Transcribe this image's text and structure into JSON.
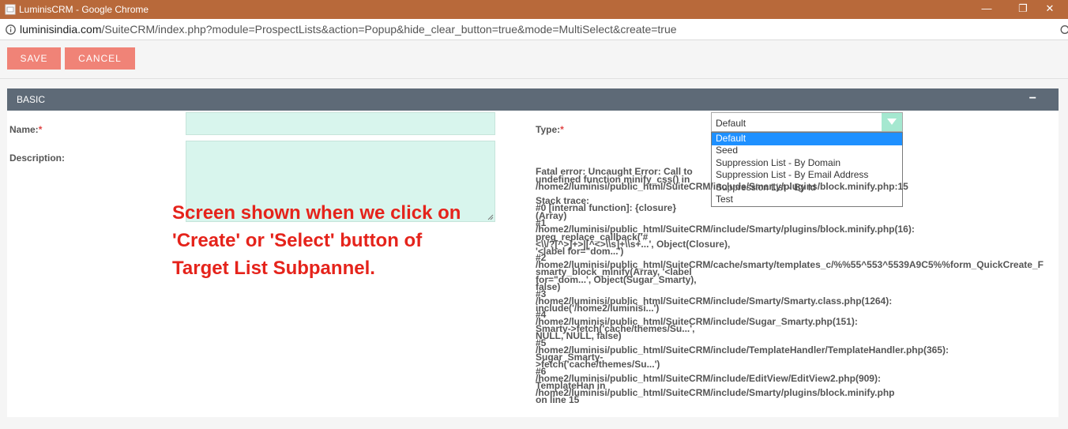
{
  "window": {
    "title": "LuminisCRM - Google Chrome",
    "minimize_glyph": "—",
    "restore_glyph": "❐",
    "close_glyph": "✕"
  },
  "address": {
    "host": "luminisindia.com",
    "path": "/SuiteCRM/index.php?module=ProspectLists&action=Popup&hide_clear_button=true&mode=MultiSelect&create=true"
  },
  "toolbar": {
    "save_label": "SAVE",
    "cancel_label": "CANCEL"
  },
  "panel": {
    "title": "BASIC",
    "collapse_glyph": "−",
    "name_label": "Name:",
    "required_mark": "*",
    "description_label": "Description:",
    "type_label": "Type:",
    "name_value": "",
    "description_value": ""
  },
  "type_select": {
    "value": "Default",
    "options": [
      "Default",
      "Seed",
      "Suppression List - By Domain",
      "Suppression List - By Email Address",
      "Suppression List - By Id",
      "Test"
    ],
    "selected_index": 0
  },
  "error_lines": [
    "Fatal error:  Uncaught Error: Call to",
    "undefined function minify_css() in",
    "/home2/luminisi/public_html/SuiteCRM/include/Smarty/plugins/block.minify.php:15",
    "Stack trace:",
    "#0 [internal function]: {closure}",
    "(Array)",
    "#1",
    "/home2/luminisi/public_html/SuiteCRM/include/Smarty/plugins/block.minify.php(16):",
    " preg_replace_callback('#",
    "<\\\\/?[^>]+>|[^<>\\\\s]+\\\\s+...', Object(Closure),",
    " '<label for=\"dom...')",
    "#2",
    "/home2/luminisi/public_html/SuiteCRM/cache/smarty/templates_c/%%55^553^5539A9C5%%form_QuickCreate_F",
    " smarty_block_minify(Array, '<label",
    "for=\"dom...', Object(Sugar_Smarty),",
    "false)",
    "#3",
    "/home2/luminisi/public_html/SuiteCRM/include/Smarty/Smarty.class.php(1264):",
    " include('/home2/luminisi...')",
    "#4",
    "/home2/luminisi/public_html/SuiteCRM/include/Sugar_Smarty.php(151):",
    " Smarty->fetch('cache/themes/Su...',",
    "NULL, NULL, false)",
    "#5",
    "/home2/luminisi/public_html/SuiteCRM/include/TemplateHandler/TemplateHandler.php(365):",
    " Sugar_Smarty-",
    ">fetch('cache/themes/Su...')",
    "#6",
    "/home2/luminisi/public_html/SuiteCRM/include/EditView/EditView2.php(909):",
    " TemplateHan in",
    "/home2/luminisi/public_html/SuiteCRM/include/Smarty/plugins/block.minify.php",
    " on line 15"
  ],
  "annotation": {
    "lines": [
      "Screen shown when we click on",
      "'Create' or 'Select' button of",
      "Target List Subpannel."
    ],
    "color": "#e5231b"
  },
  "colors": {
    "titlebar": "#b8693a",
    "button": "#f08377",
    "panel_header": "#5e6a77",
    "input_bg": "#d8f5ed",
    "selected_option": "#1e90ff"
  }
}
